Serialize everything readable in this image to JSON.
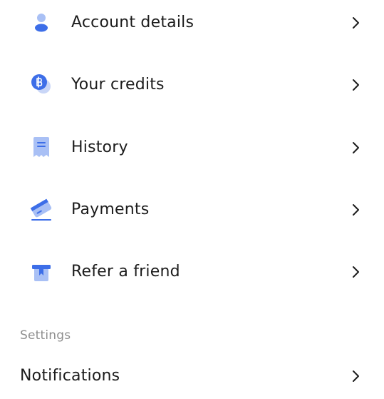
{
  "menu": {
    "items": [
      {
        "label": "Account details",
        "icon": "user-icon"
      },
      {
        "label": "Your credits",
        "icon": "credits-coin-icon"
      },
      {
        "label": "History",
        "icon": "receipt-icon"
      },
      {
        "label": "Payments",
        "icon": "credit-card-icon"
      },
      {
        "label": "Refer a friend",
        "icon": "gift-icon"
      }
    ]
  },
  "settings": {
    "header": "Settings",
    "items": [
      {
        "label": "Notifications"
      }
    ]
  },
  "colors": {
    "accent": "#3d6ee8",
    "accent_light": "#a9c0f5",
    "section_header": "#8e8e8e",
    "text": "#1c1c1c",
    "chevron": "#1c1c1c"
  }
}
